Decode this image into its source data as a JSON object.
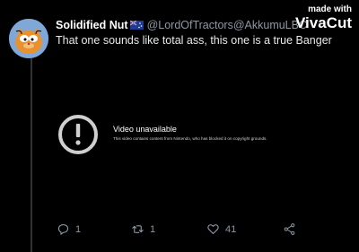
{
  "tweet": {
    "display_name": "Solidified Nut",
    "handle": "@LordOfTractors@AkkumuLBC",
    "text": "That one sounds like total ass, this one is a true Banger",
    "avatar_icon": "garfield-avatar"
  },
  "watermark": {
    "top": "made with",
    "brand": "VivaCut"
  },
  "video": {
    "title": "Video unavailable",
    "message": "This video contains content from Nintendo, who has blocked it on copyright grounds.",
    "icon": "alert-icon"
  },
  "actions": {
    "reply_count": "1",
    "retweet_count": "1",
    "like_count": "41"
  },
  "colors": {
    "background": "#000000",
    "muted": "#8b98a5"
  }
}
